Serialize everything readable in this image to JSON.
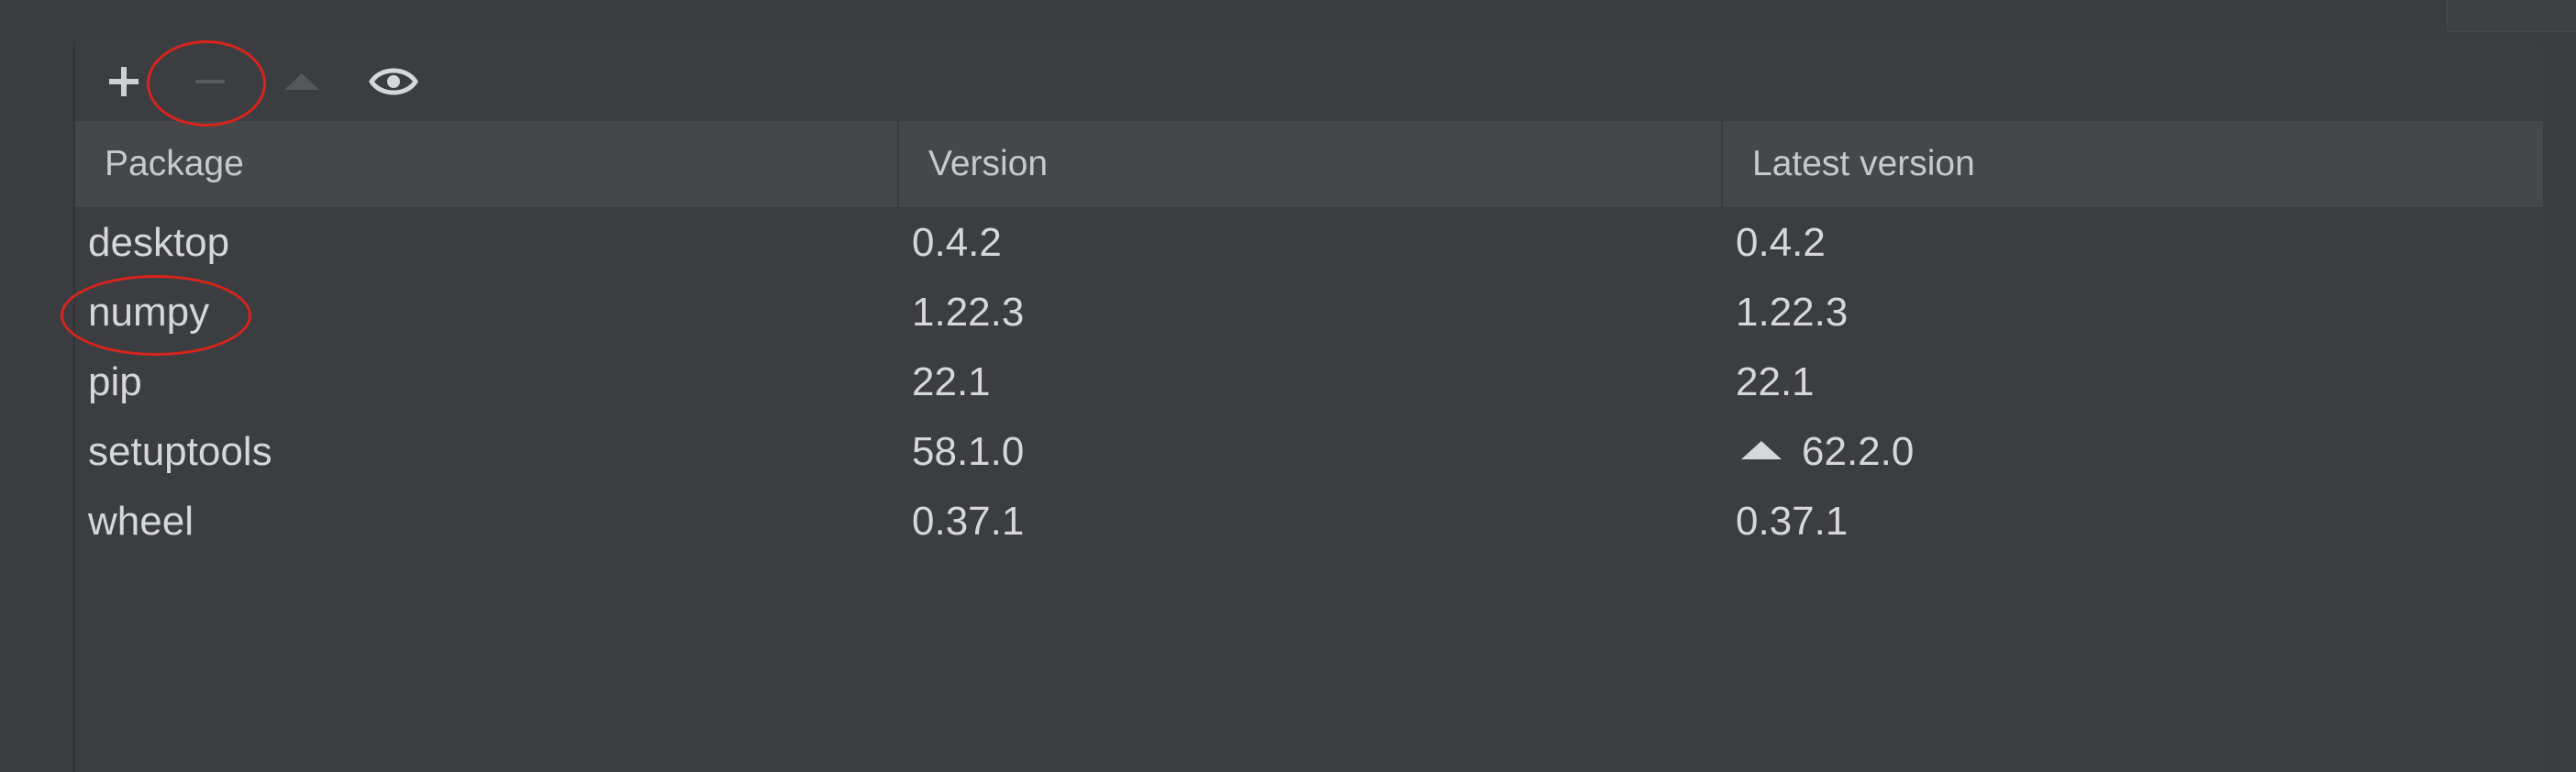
{
  "toolbar": {
    "add_icon": "plus-icon",
    "remove_icon": "minus-icon",
    "upgrade_icon": "triangle-up-icon",
    "view_icon": "eye-icon"
  },
  "table": {
    "columns": [
      "Package",
      "Version",
      "Latest version"
    ],
    "rows": [
      {
        "package": "desktop",
        "version": "0.4.2",
        "latest": "0.4.2",
        "upgrade": false
      },
      {
        "package": "numpy",
        "version": "1.22.3",
        "latest": "1.22.3",
        "upgrade": false
      },
      {
        "package": "pip",
        "version": "22.1",
        "latest": "22.1",
        "upgrade": false
      },
      {
        "package": "setuptools",
        "version": "58.1.0",
        "latest": "62.2.0",
        "upgrade": true
      },
      {
        "package": "wheel",
        "version": "0.37.1",
        "latest": "0.37.1",
        "upgrade": false
      }
    ]
  },
  "colors": {
    "background": "#3b3c3f",
    "header": "#45474a",
    "text": "#d6d7d9",
    "annotation": "#d8241c"
  }
}
